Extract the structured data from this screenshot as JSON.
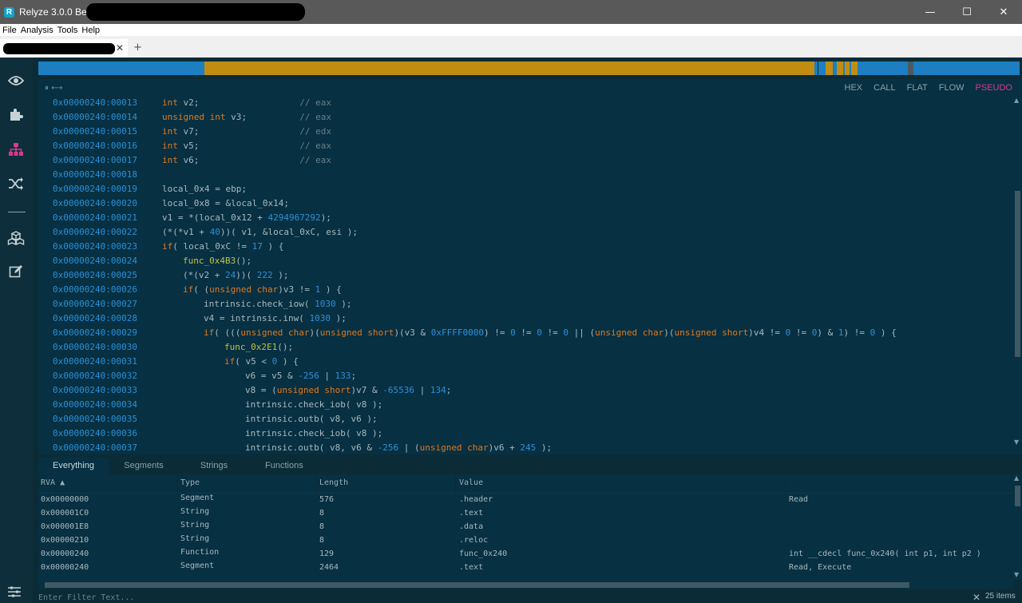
{
  "window": {
    "title": "Relyze 3.0.0 Beta -",
    "logo_letter": "R",
    "minimize": "—",
    "maximize": "☐",
    "close": "✕"
  },
  "menu": [
    "File",
    "Analysis",
    "Tools",
    "Help"
  ],
  "doc_tab": {
    "close": "✕",
    "new": "+"
  },
  "sidebar_icons": [
    "eye-icon",
    "puzzle-icon",
    "hierarchy-icon",
    "shuffle-icon",
    "cubes-icon",
    "edit-icon"
  ],
  "code_view": {
    "toolbar_icons": "⏸  ⟷",
    "modes": [
      {
        "label": "HEX",
        "active": false
      },
      {
        "label": "CALL",
        "active": false
      },
      {
        "label": "FLAT",
        "active": false
      },
      {
        "label": "FLOW",
        "active": false
      },
      {
        "label": "PSEUDO",
        "active": true
      }
    ],
    "lines": [
      {
        "addr": "0x00000240:00013",
        "indent": 0,
        "parts": [
          [
            "kw",
            "int"
          ],
          [
            "code",
            " v2;                   "
          ],
          [
            "cm",
            "// eax"
          ]
        ]
      },
      {
        "addr": "0x00000240:00014",
        "indent": 0,
        "parts": [
          [
            "kw",
            "unsigned int"
          ],
          [
            "code",
            " v3;          "
          ],
          [
            "cm",
            "// eax"
          ]
        ]
      },
      {
        "addr": "0x00000240:00015",
        "indent": 0,
        "parts": [
          [
            "kw",
            "int"
          ],
          [
            "code",
            " v7;                   "
          ],
          [
            "cm",
            "// edx"
          ]
        ]
      },
      {
        "addr": "0x00000240:00016",
        "indent": 0,
        "parts": [
          [
            "kw",
            "int"
          ],
          [
            "code",
            " v5;                   "
          ],
          [
            "cm",
            "// eax"
          ]
        ]
      },
      {
        "addr": "0x00000240:00017",
        "indent": 0,
        "parts": [
          [
            "kw",
            "int"
          ],
          [
            "code",
            " v6;                   "
          ],
          [
            "cm",
            "// eax"
          ]
        ]
      },
      {
        "addr": "0x00000240:00018",
        "indent": 0,
        "parts": []
      },
      {
        "addr": "0x00000240:00019",
        "indent": 0,
        "parts": [
          [
            "code",
            "local_0x4 = ebp;"
          ]
        ]
      },
      {
        "addr": "0x00000240:00020",
        "indent": 0,
        "parts": [
          [
            "code",
            "local_0x8 = &local_0x14;"
          ]
        ]
      },
      {
        "addr": "0x00000240:00021",
        "indent": 0,
        "parts": [
          [
            "code",
            "v1 = *(local_0x12 + "
          ],
          [
            "num",
            "4294967292"
          ],
          [
            "code",
            ");"
          ]
        ]
      },
      {
        "addr": "0x00000240:00022",
        "indent": 0,
        "parts": [
          [
            "code",
            "(*(*v1 + "
          ],
          [
            "num",
            "40"
          ],
          [
            "code",
            "))( v1, &local_0xC, esi );"
          ]
        ]
      },
      {
        "addr": "0x00000240:00023",
        "indent": 0,
        "parts": [
          [
            "kw",
            "if"
          ],
          [
            "code",
            "( local_0xC != "
          ],
          [
            "num",
            "17"
          ],
          [
            "code",
            " ) {"
          ]
        ]
      },
      {
        "addr": "0x00000240:00024",
        "indent": 1,
        "parts": [
          [
            "fn",
            "func_0x4B3"
          ],
          [
            "code",
            "();"
          ]
        ]
      },
      {
        "addr": "0x00000240:00025",
        "indent": 1,
        "parts": [
          [
            "code",
            "(*(v2 + "
          ],
          [
            "num",
            "24"
          ],
          [
            "code",
            "))( "
          ],
          [
            "num",
            "222"
          ],
          [
            "code",
            " );"
          ]
        ]
      },
      {
        "addr": "0x00000240:00026",
        "indent": 1,
        "parts": [
          [
            "kw",
            "if"
          ],
          [
            "code",
            "( ("
          ],
          [
            "kw",
            "unsigned char"
          ],
          [
            "code",
            ")v3 != "
          ],
          [
            "num",
            "1"
          ],
          [
            "code",
            " ) {"
          ]
        ]
      },
      {
        "addr": "0x00000240:00027",
        "indent": 2,
        "parts": [
          [
            "code",
            "intrinsic.check_iow( "
          ],
          [
            "num",
            "1030"
          ],
          [
            "code",
            " );"
          ]
        ]
      },
      {
        "addr": "0x00000240:00028",
        "indent": 2,
        "parts": [
          [
            "code",
            "v4 = intrinsic.inw( "
          ],
          [
            "num",
            "1030"
          ],
          [
            "code",
            " );"
          ]
        ]
      },
      {
        "addr": "0x00000240:00029",
        "indent": 2,
        "parts": [
          [
            "kw",
            "if"
          ],
          [
            "code",
            "( ((("
          ],
          [
            "kw",
            "unsigned char"
          ],
          [
            "code",
            ")("
          ],
          [
            "kw",
            "unsigned short"
          ],
          [
            "code",
            ")(v3 & "
          ],
          [
            "num",
            "0xFFFF0000"
          ],
          [
            "code",
            ") != "
          ],
          [
            "num",
            "0"
          ],
          [
            "code",
            " != "
          ],
          [
            "num",
            "0"
          ],
          [
            "code",
            " != "
          ],
          [
            "num",
            "0"
          ],
          [
            "code",
            " || ("
          ],
          [
            "kw",
            "unsigned char"
          ],
          [
            "code",
            ")("
          ],
          [
            "kw",
            "unsigned short"
          ],
          [
            "code",
            ")v4 != "
          ],
          [
            "num",
            "0"
          ],
          [
            "code",
            " != "
          ],
          [
            "num",
            "0"
          ],
          [
            "code",
            ") & "
          ],
          [
            "num",
            "1"
          ],
          [
            "code",
            ") != "
          ],
          [
            "num",
            "0"
          ],
          [
            "code",
            " ) {"
          ]
        ]
      },
      {
        "addr": "0x00000240:00030",
        "indent": 3,
        "parts": [
          [
            "fn",
            "func_0x2E1"
          ],
          [
            "code",
            "();"
          ]
        ]
      },
      {
        "addr": "0x00000240:00031",
        "indent": 3,
        "parts": [
          [
            "kw",
            "if"
          ],
          [
            "code",
            "( v5 < "
          ],
          [
            "num",
            "0"
          ],
          [
            "code",
            " ) {"
          ]
        ]
      },
      {
        "addr": "0x00000240:00032",
        "indent": 4,
        "parts": [
          [
            "code",
            "v6 = v5 & "
          ],
          [
            "num",
            "-256"
          ],
          [
            "code",
            " | "
          ],
          [
            "num",
            "133"
          ],
          [
            "code",
            ";"
          ]
        ]
      },
      {
        "addr": "0x00000240:00033",
        "indent": 4,
        "parts": [
          [
            "code",
            "v8 = ("
          ],
          [
            "kw",
            "unsigned short"
          ],
          [
            "code",
            ")v7 & "
          ],
          [
            "num",
            "-65536"
          ],
          [
            "code",
            " | "
          ],
          [
            "num",
            "134"
          ],
          [
            "code",
            ";"
          ]
        ]
      },
      {
        "addr": "0x00000240:00034",
        "indent": 4,
        "parts": [
          [
            "code",
            "intrinsic.check_iob( v8 );"
          ]
        ]
      },
      {
        "addr": "0x00000240:00035",
        "indent": 4,
        "parts": [
          [
            "code",
            "intrinsic.outb( v8, v6 );"
          ]
        ]
      },
      {
        "addr": "0x00000240:00036",
        "indent": 4,
        "parts": [
          [
            "code",
            "intrinsic.check_iob( v8 );"
          ]
        ]
      },
      {
        "addr": "0x00000240:00037",
        "indent": 4,
        "parts": [
          [
            "code",
            "intrinsic.outb( v8, v6 & "
          ],
          [
            "num",
            "-256"
          ],
          [
            "code",
            " | ("
          ],
          [
            "kw",
            "unsigned char"
          ],
          [
            "code",
            ")v6 + "
          ],
          [
            "num",
            "245"
          ],
          [
            "code",
            " );"
          ]
        ]
      }
    ]
  },
  "bottom": {
    "tabs": [
      {
        "label": "Everything",
        "active": true
      },
      {
        "label": "Segments",
        "active": false
      },
      {
        "label": "Strings",
        "active": false
      },
      {
        "label": "Functions",
        "active": false
      }
    ],
    "columns": [
      "RVA ▲",
      "Type",
      "Length",
      "Value",
      ""
    ],
    "rows": [
      [
        "0x00000000",
        "Segment",
        "576",
        ".header",
        "Read"
      ],
      [
        "0x000001C0",
        "String",
        "8",
        ".text",
        ""
      ],
      [
        "0x000001E8",
        "String",
        "8",
        ".data",
        ""
      ],
      [
        "0x00000210",
        "String",
        "8",
        ".reloc",
        ""
      ],
      [
        "0x00000240",
        "Function",
        "129",
        "func_0x240",
        "int __cdecl func_0x240( int p1, int p2 )"
      ],
      [
        "0x00000240",
        "Segment",
        "2464",
        ".text",
        "Read, Execute"
      ]
    ],
    "filter_placeholder": "Enter Filter Text...",
    "filter_clear": "✕",
    "item_count": "25 items"
  },
  "colors": {
    "nav_blue": "#1d7fc2",
    "nav_gold": "#c08d12",
    "accent_pink": "#d63a8f"
  }
}
